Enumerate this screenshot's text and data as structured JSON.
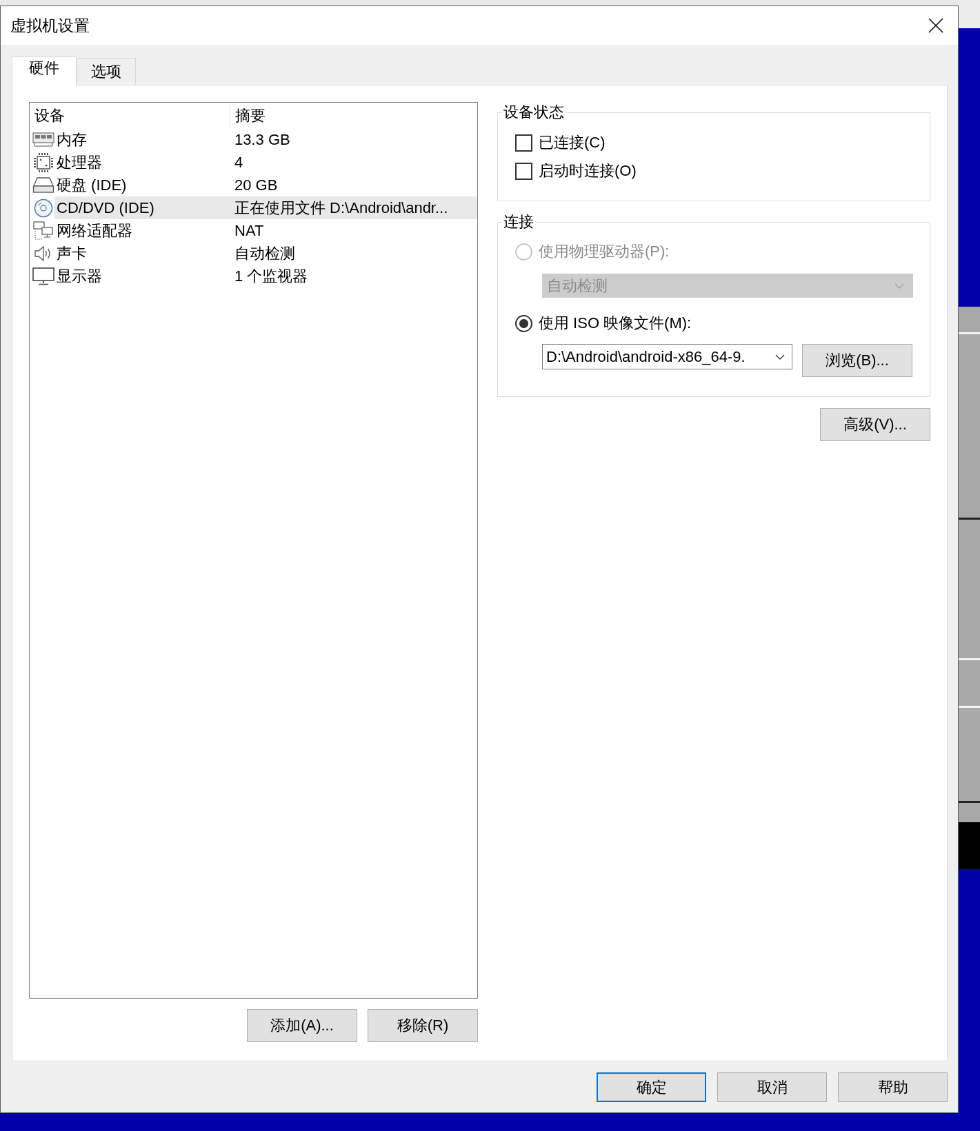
{
  "window": {
    "title": "虚拟机设置"
  },
  "tabs": [
    {
      "label": "硬件",
      "selected": true
    },
    {
      "label": "选项",
      "selected": false
    }
  ],
  "device_list": {
    "columns": [
      "设备",
      "摘要"
    ],
    "rows": [
      {
        "kind": "memory",
        "device": "内存",
        "summary": "13.3 GB",
        "selected": false
      },
      {
        "kind": "processor",
        "device": "处理器",
        "summary": "4",
        "selected": false
      },
      {
        "kind": "hard_disk",
        "device": "硬盘 (IDE)",
        "summary": "20 GB",
        "selected": false
      },
      {
        "kind": "cd_dvd",
        "device": "CD/DVD (IDE)",
        "summary": "正在使用文件 D:\\Android\\andr...",
        "selected": true
      },
      {
        "kind": "network",
        "device": "网络适配器",
        "summary": "NAT",
        "selected": false
      },
      {
        "kind": "sound",
        "device": "声卡",
        "summary": "自动检测",
        "selected": false
      },
      {
        "kind": "display",
        "device": "显示器",
        "summary": "1 个监视器",
        "selected": false
      }
    ]
  },
  "list_buttons": [
    "添加(A)...",
    "移除(R)"
  ],
  "device_status": {
    "title": "设备状态",
    "checkboxes": [
      {
        "label": "已连接(C)",
        "checked": false
      },
      {
        "label": "启动时连接(O)",
        "checked": false
      }
    ]
  },
  "connection": {
    "title": "连接",
    "options": [
      {
        "kind": "drive",
        "label": "使用物理驱动器(P):",
        "selected": false,
        "disabled": true,
        "dropdown": "自动检测"
      },
      {
        "kind": "image",
        "label": "使用 ISO 映像文件(M):",
        "selected": true,
        "disabled": false,
        "path": "D:\\Android\\android-x86_64-9.",
        "browse_button": "浏览(B)..."
      }
    ]
  },
  "advanced_button": "高级(V)...",
  "dialog_buttons": [
    {
      "label": "确定",
      "default": true
    },
    {
      "label": "取消",
      "default": false
    },
    {
      "label": "帮助",
      "default": false
    }
  ]
}
